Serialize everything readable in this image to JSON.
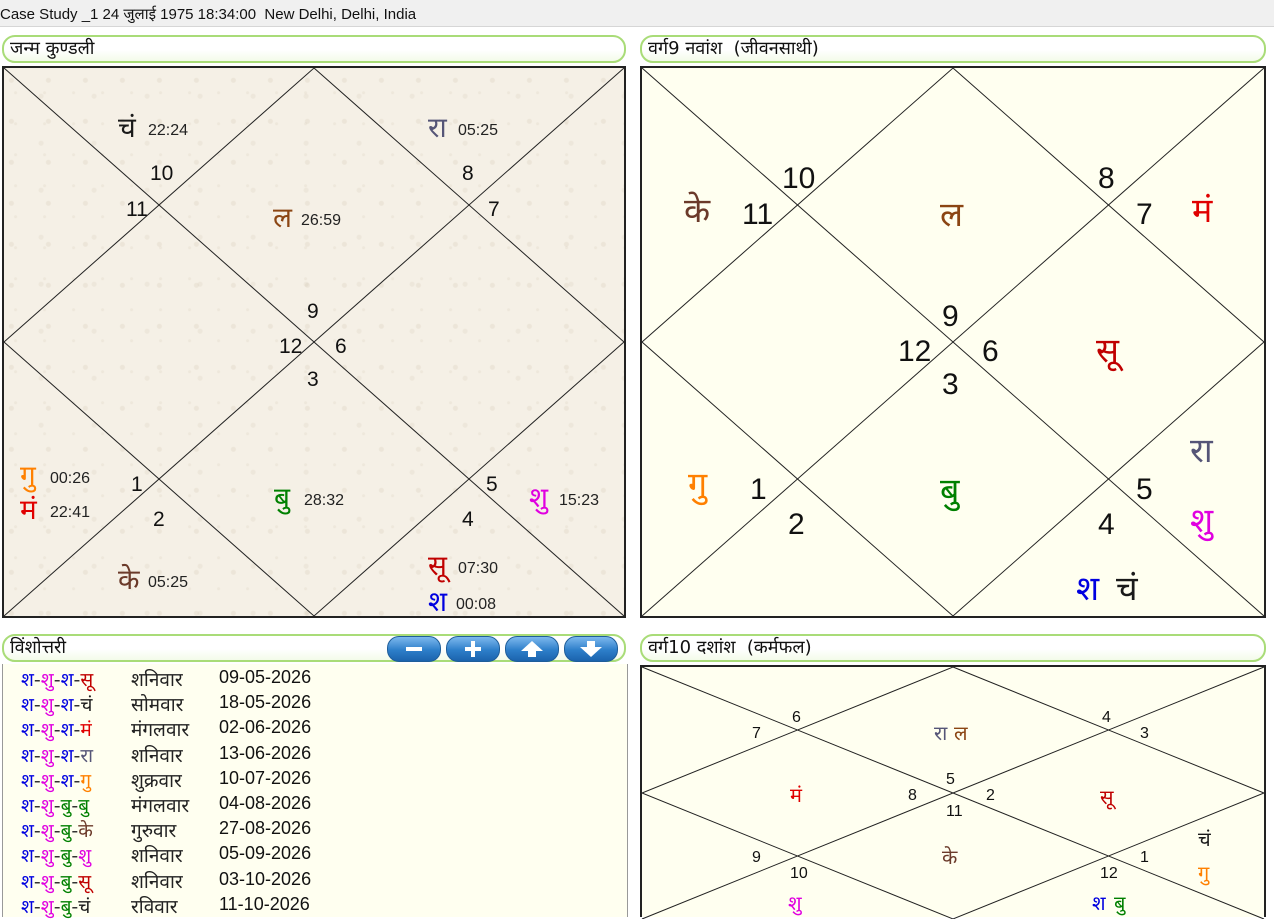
{
  "window": {
    "title": "Case Study _1 24 जुलाई 1975 18:34:00  New Delhi, Delhi, India"
  },
  "colors": {
    "surya": "#c00000",
    "chandra": "#1a1a1a",
    "mangal": "#e00000",
    "budh": "#008000",
    "guru": "#ff8000",
    "shukra": "#e000e0",
    "shani": "#0000e0",
    "rahu": "#555577",
    "ketu": "#6b3a2a",
    "lagna": "#8b4513"
  },
  "janma": {
    "title": "जन्म कुण्डली",
    "numbers": [
      "10",
      "11",
      "8",
      "7",
      "9",
      "12",
      "6",
      "3",
      "1",
      "2",
      "5",
      "4"
    ],
    "planets": [
      {
        "glyph": "चं",
        "deg": "22:24",
        "color": "#1a1a1a"
      },
      {
        "glyph": "रा",
        "deg": "05:25",
        "color": "#555577"
      },
      {
        "glyph": "ल",
        "deg": "26:59",
        "color": "#8b4513"
      },
      {
        "glyph": "गु",
        "deg": "00:26",
        "color": "#ff8000"
      },
      {
        "glyph": "मं",
        "deg": "22:41",
        "color": "#e00000"
      },
      {
        "glyph": "बु",
        "deg": "28:32",
        "color": "#008000"
      },
      {
        "glyph": "शु",
        "deg": "15:23",
        "color": "#e000e0"
      },
      {
        "glyph": "के",
        "deg": "05:25",
        "color": "#6b3a2a"
      },
      {
        "glyph": "सू",
        "deg": "07:30",
        "color": "#c00000"
      },
      {
        "glyph": "श",
        "deg": "00:08",
        "color": "#0000e0"
      }
    ]
  },
  "navamsha": {
    "title": "वर्ग9 नवांश  (जीवनसाथी)",
    "numbers": [
      "10",
      "11",
      "8",
      "7",
      "9",
      "12",
      "6",
      "3",
      "1",
      "2",
      "5",
      "4"
    ],
    "planets": [
      {
        "glyph": "के",
        "color": "#6b3a2a"
      },
      {
        "glyph": "ल",
        "color": "#8b4513"
      },
      {
        "glyph": "मं",
        "color": "#e00000"
      },
      {
        "glyph": "सू",
        "color": "#c00000"
      },
      {
        "glyph": "रा",
        "color": "#555577"
      },
      {
        "glyph": "गु",
        "color": "#ff8000"
      },
      {
        "glyph": "बु",
        "color": "#008000"
      },
      {
        "glyph": "शु",
        "color": "#e000e0"
      },
      {
        "glyph": "श",
        "color": "#0000e0"
      },
      {
        "glyph": "चं",
        "color": "#1a1a1a"
      }
    ]
  },
  "vimshottari": {
    "title": "विंशोत्तरी",
    "buttons": [
      "minus-icon",
      "plus-icon",
      "arrow-up-icon",
      "arrow-down-icon"
    ],
    "rows": [
      {
        "p": [
          [
            "श",
            "#0000e0"
          ],
          [
            "शु",
            "#e000e0"
          ],
          [
            "श",
            "#0000e0"
          ],
          [
            "सू",
            "#c00000"
          ]
        ],
        "day": "शनिवार",
        "date": "09-05-2026"
      },
      {
        "p": [
          [
            "श",
            "#0000e0"
          ],
          [
            "शु",
            "#e000e0"
          ],
          [
            "श",
            "#0000e0"
          ],
          [
            "चं",
            "#1a1a1a"
          ]
        ],
        "day": "सोमवार",
        "date": "18-05-2026"
      },
      {
        "p": [
          [
            "श",
            "#0000e0"
          ],
          [
            "शु",
            "#e000e0"
          ],
          [
            "श",
            "#0000e0"
          ],
          [
            "मं",
            "#e00000"
          ]
        ],
        "day": "मंगलवार",
        "date": "02-06-2026"
      },
      {
        "p": [
          [
            "श",
            "#0000e0"
          ],
          [
            "शु",
            "#e000e0"
          ],
          [
            "श",
            "#0000e0"
          ],
          [
            "रा",
            "#555577"
          ]
        ],
        "day": "शनिवार",
        "date": "13-06-2026"
      },
      {
        "p": [
          [
            "श",
            "#0000e0"
          ],
          [
            "शु",
            "#e000e0"
          ],
          [
            "श",
            "#0000e0"
          ],
          [
            "गु",
            "#ff8000"
          ]
        ],
        "day": "शुक्रवार",
        "date": "10-07-2026"
      },
      {
        "p": [
          [
            "श",
            "#0000e0"
          ],
          [
            "शु",
            "#e000e0"
          ],
          [
            "बु",
            "#008000"
          ],
          [
            "बु",
            "#008000"
          ]
        ],
        "day": "मंगलवार",
        "date": "04-08-2026"
      },
      {
        "p": [
          [
            "श",
            "#0000e0"
          ],
          [
            "शु",
            "#e000e0"
          ],
          [
            "बु",
            "#008000"
          ],
          [
            "के",
            "#6b3a2a"
          ]
        ],
        "day": "गुरुवार",
        "date": "27-08-2026"
      },
      {
        "p": [
          [
            "श",
            "#0000e0"
          ],
          [
            "शु",
            "#e000e0"
          ],
          [
            "बु",
            "#008000"
          ],
          [
            "शु",
            "#e000e0"
          ]
        ],
        "day": "शनिवार",
        "date": "05-09-2026"
      },
      {
        "p": [
          [
            "श",
            "#0000e0"
          ],
          [
            "शु",
            "#e000e0"
          ],
          [
            "बु",
            "#008000"
          ],
          [
            "सू",
            "#c00000"
          ]
        ],
        "day": "शनिवार",
        "date": "03-10-2026"
      },
      {
        "p": [
          [
            "श",
            "#0000e0"
          ],
          [
            "शु",
            "#e000e0"
          ],
          [
            "बु",
            "#008000"
          ],
          [
            "चं",
            "#1a1a1a"
          ]
        ],
        "day": "रविवार",
        "date": "11-10-2026"
      }
    ]
  },
  "dashamsha": {
    "title": "वर्ग10 दशांश  (कर्मफल)",
    "numbers": [
      "6",
      "7",
      "4",
      "3",
      "5",
      "8",
      "2",
      "11",
      "9",
      "10",
      "1",
      "12"
    ],
    "planets": [
      {
        "glyph": "रा",
        "color": "#555577"
      },
      {
        "glyph": "ल",
        "color": "#8b4513"
      },
      {
        "glyph": "मं",
        "color": "#e00000"
      },
      {
        "glyph": "सू",
        "color": "#c00000"
      },
      {
        "glyph": "के",
        "color": "#6b3a2a"
      },
      {
        "glyph": "चं",
        "color": "#1a1a1a"
      },
      {
        "glyph": "गु",
        "color": "#ff8000"
      },
      {
        "glyph": "शु",
        "color": "#e000e0"
      },
      {
        "glyph": "श",
        "color": "#0000e0"
      },
      {
        "glyph": "बु",
        "color": "#008000"
      }
    ]
  }
}
